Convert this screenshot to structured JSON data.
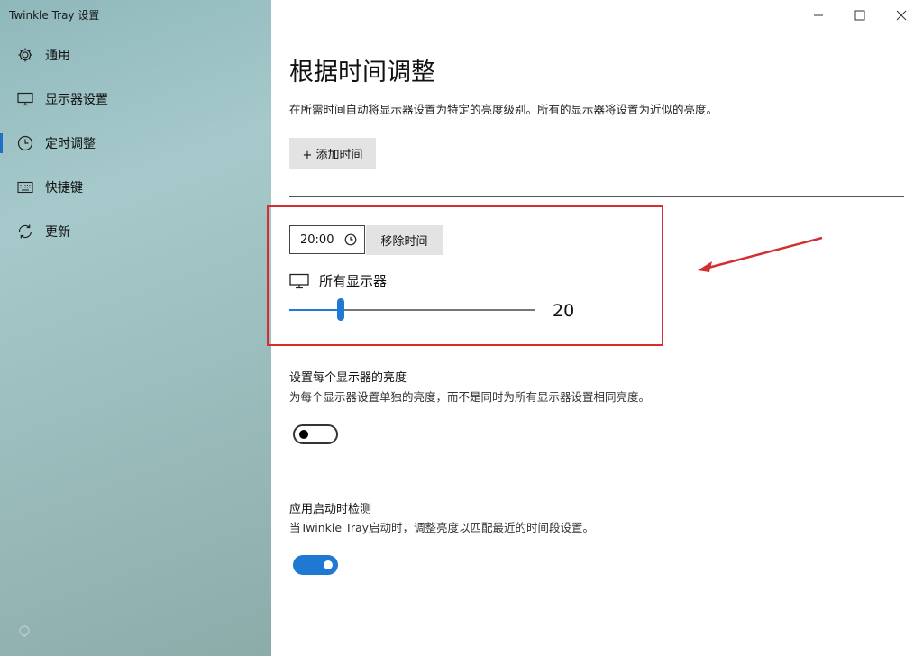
{
  "window": {
    "title": "Twinkle Tray 设置",
    "controls": [
      "minimize-icon",
      "maximize-icon",
      "close-icon"
    ]
  },
  "sidebar": {
    "items": [
      {
        "label": "通用",
        "icon": "gear-icon",
        "active": false
      },
      {
        "label": "显示器设置",
        "icon": "monitor-icon",
        "active": false
      },
      {
        "label": "定时调整",
        "icon": "clock-icon",
        "active": true
      },
      {
        "label": "快捷键",
        "icon": "keyboard-icon",
        "active": false
      },
      {
        "label": "更新",
        "icon": "refresh-icon",
        "active": false
      }
    ],
    "accent": "#1f6fc4"
  },
  "main": {
    "title": "根据时间调整",
    "description": "在所需时间自动将显示器设置为特定的亮度级别。所有的显示器将设置为近似的亮度。",
    "add_button": "+ 添加时间",
    "schedule": {
      "time": "20:00",
      "remove_button": "移除时间",
      "monitor_label": "所有显示器",
      "brightness": 20,
      "brightness_display": "20",
      "annotation_color": "#d32f2f"
    },
    "per_monitor": {
      "title": "设置每个显示器的亮度",
      "description": "为每个显示器设置单独的亮度，而不是同时为所有显示器设置相同亮度。",
      "enabled": false
    },
    "startup_check": {
      "title": "应用启动时检测",
      "description": "当Twinkle Tray启动时，调整亮度以匹配最近的时间段设置。",
      "enabled": true
    },
    "accent": "#1f78d1"
  }
}
